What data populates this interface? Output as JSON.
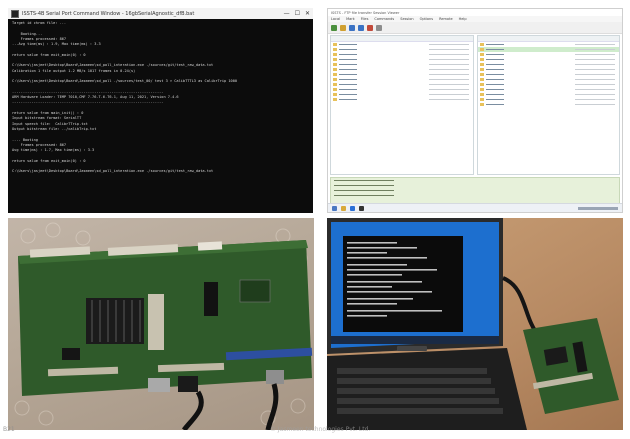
{
  "screenshot_panels": {
    "cmd_window": {
      "title": "ISSTS-4B Serial Port Command Window - 16gbSerialAgnostic_dfB.bat",
      "controls": [
        "—",
        "☐",
        "✕"
      ],
      "lines": [
        "Target id chrom file: ...",
        "",
        "    Booting...",
        "    Frames processed: 867",
        "...Avg time(ms) : 1.9, Max time(ms) : 3.3",
        "",
        "return value from exit_main(0) : 0",
        "",
        "C:\\Users\\jasjeet\\Desktop\\Board\\Jasmeen\\sd_poll_interation.exe ./sources/git/test_raw_data.txt",
        "Calibration 1 file output 1.2 MB/s 1017 frames in 0.24(s)",
        "",
        "C:\\Users\\jasjeet\\Desktop\\Board\\Jasmeen\\sd_poll ./sources/test_00/ test 3 > CalibTTTL3 as CalibrTrip 1000",
        "",
        "----------------------------------------------------------------------",
        "ARM Hardware Loader: TEMP 7010,CMF 7.76.T.6.T6.1, Aug 11, 2021, Version 7.4.6",
        "----------------------------------------------------------------------",
        "",
        "return value from main_init() : 0",
        "Input bitstream format: SerialTT",
        "Input speech file:  CalibrTTrip.txt",
        "Output bitstream file: ../calibTrip.txt",
        "",
        "---- Booting",
        "    Frames processed: 867",
        "Avg time(ms) : 1.7, Max time(ms) : 3.3",
        "",
        "return value from exit_main(0) : 0",
        "",
        "C:\\Users\\jasjeet\\Desktop\\Board\\Jasmeen\\sd_poll_interation.exe ./sources/git/test_raw_data.txt",
        ""
      ]
    },
    "transfer_app": {
      "title": "ISSTS - FTP file transfer  Session Viewer",
      "menu": [
        "Local",
        "Mark",
        "Files",
        "Commands",
        "Session",
        "Options",
        "Remote",
        "Help"
      ]
    }
  },
  "bottom_labels": {
    "left": "B21",
    "watermark": "© Jasmeen technologies Pvt. Ltd."
  },
  "colors": {
    "cmd_background": "#0c0c0c",
    "cmd_text": "#d8d8d8",
    "app_selection": "#cfeccc",
    "log_panel": "#e7f1da",
    "pcb_green": "#2f5a2a",
    "laptop_screen": "#1d6fcf"
  }
}
